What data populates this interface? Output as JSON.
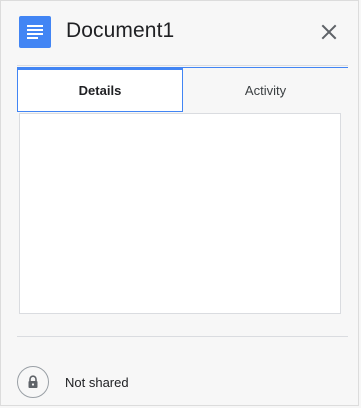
{
  "header": {
    "title": "Document1",
    "doc_icon": "google-docs-icon",
    "close_icon": "close-icon",
    "accent_color": "#4285f4"
  },
  "tabs": [
    {
      "label": "Details",
      "selected": true
    },
    {
      "label": "Activity",
      "selected": false
    }
  ],
  "sharing": {
    "icon": "lock-icon",
    "status": "Not shared"
  }
}
